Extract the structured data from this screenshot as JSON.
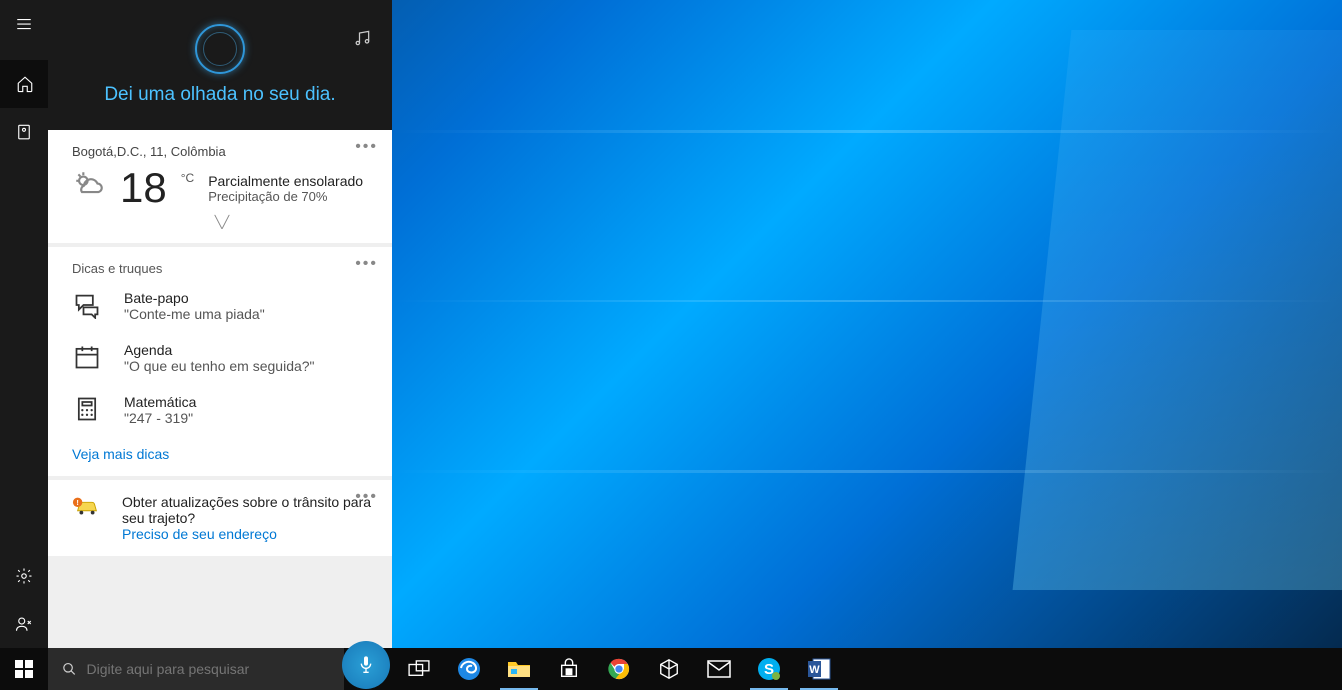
{
  "cortana": {
    "greeting": "Dei uma olhada no seu dia."
  },
  "weather": {
    "location": "Bogotá,D.C., 11, Colômbia",
    "temp": "18",
    "unit": "°C",
    "condition": "Parcialmente ensolarado",
    "precip": "Precipitação de 70%"
  },
  "tips": {
    "title": "Dicas e truques",
    "items": [
      {
        "label": "Bate-papo",
        "example": "\"Conte-me uma piada\""
      },
      {
        "label": "Agenda",
        "example": "\"O que eu tenho em seguida?\""
      },
      {
        "label": "Matemática",
        "example": "\"247 - 319\""
      }
    ],
    "more_link": "Veja mais dicas"
  },
  "traffic": {
    "title": "Obter atualizações sobre o trânsito para seu trajeto?",
    "link": "Preciso de seu endereço"
  },
  "taskbar": {
    "search_placeholder": "Digite aqui para pesquisar"
  }
}
